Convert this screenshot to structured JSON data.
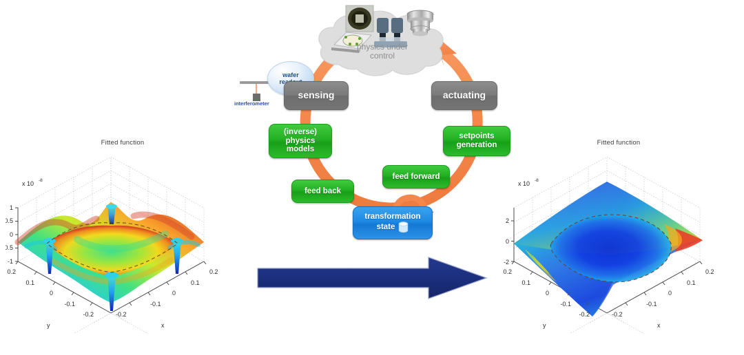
{
  "page": {
    "background": "#ffffff",
    "description": "Control loop diagram between two MATLAB fitted-function surface plots"
  },
  "colors": {
    "ring_orange": "#f4874b",
    "node_gray": "#7a7a7a",
    "node_green": "#23b023",
    "node_blue": "#1e8ae2",
    "bubble_blue": "#c3dcf4",
    "cloud_gray": "#dcdcdc",
    "cloud_text": "#8d8d8d",
    "arrow_navy": "#1b2f7e",
    "interferometer_text": "#2a4fb5"
  },
  "loop": {
    "cloud": {
      "label": "physics under control",
      "line1": "physics under",
      "line2": "control",
      "icons": [
        "wafer-image-icon",
        "wafer-stage-icon",
        "microscope-icon",
        "lens-barrel-icon"
      ]
    },
    "bubble": {
      "line1": "wafer",
      "line2": "readout",
      "label": "wafer readout"
    },
    "interferometer_label": "interferometer",
    "nodes": [
      {
        "id": "sensing",
        "label": "sensing",
        "style": "gray",
        "lines": [
          "sensing"
        ]
      },
      {
        "id": "actuating",
        "label": "actuating",
        "style": "gray",
        "lines": [
          "actuating"
        ]
      },
      {
        "id": "inverse-physics-models",
        "label": "(inverse) physics models",
        "style": "green",
        "lines": [
          "(inverse)",
          "physics",
          "models"
        ]
      },
      {
        "id": "setpoints-generation",
        "label": "setpoints generation",
        "style": "green",
        "lines": [
          "setpoints",
          "generation"
        ]
      },
      {
        "id": "feed-back",
        "label": "feed back",
        "style": "green",
        "lines": [
          "feed back"
        ]
      },
      {
        "id": "feed-forward",
        "label": "feed forward",
        "style": "green",
        "lines": [
          "feed forward"
        ]
      },
      {
        "id": "transformation-state",
        "label": "transformation state",
        "style": "blue",
        "lines": [
          "transformation",
          "state"
        ],
        "icon": "database-cylinder-icon"
      }
    ],
    "ring": {
      "direction": "counter-clockwise",
      "arrowhead": "top-right-pointing-into-cloud"
    },
    "inner_arrow": {
      "from": "feed-forward",
      "to": "transformation-state-right",
      "shape": "small-orange-curved-arrow"
    }
  },
  "transition_arrow": {
    "name": "big-right-arrow",
    "direction": "right",
    "color": "#1b2f7e"
  },
  "chart_data": [
    {
      "id": "left-plot",
      "type": "surface",
      "title": "Fitted function",
      "xlabel": "x",
      "ylabel": "y",
      "zlabel": "",
      "z_exponent_label": "x 10",
      "z_exponent_value": "-8",
      "xticks": [
        "0.2",
        "0.1",
        "0",
        "-0.1",
        "-0.2"
      ],
      "yticks": [
        "0.2",
        "0.1",
        "0",
        "-0.1",
        "-0.2"
      ],
      "zticks": [
        "1",
        "0.5",
        "0",
        "-0.5",
        "-1"
      ],
      "xlim": [
        -0.2,
        0.2
      ],
      "ylim": [
        -0.2,
        0.2
      ],
      "zlim": [
        -1,
        1
      ],
      "grid": true,
      "colormap": "jet",
      "annotation": "dashed contour ring on surface",
      "surface_character": "rough wavy surface with four deep blue spikes near the corners and red/orange ridges; residual before correction"
    },
    {
      "id": "right-plot",
      "type": "surface",
      "title": "Fitted function",
      "xlabel": "x",
      "ylabel": "y",
      "zlabel": "",
      "z_exponent_label": "x 10",
      "z_exponent_value": "-8",
      "xticks": [
        "0.2",
        "0.1",
        "0",
        "-0.1",
        "-0.2"
      ],
      "yticks": [
        "0.2",
        "0.1",
        "0",
        "-0.1",
        "-0.2"
      ],
      "zticks": [
        "2",
        "0",
        "-2"
      ],
      "xlim": [
        -0.2,
        0.2
      ],
      "ylim": [
        -0.2,
        0.2
      ],
      "zlim": [
        -2,
        2
      ],
      "grid": true,
      "colormap": "jet",
      "annotation": "dashed contour ring on surface",
      "surface_character": "smooth saddle surface, deep blue bowl in the centre rising to red at the right corner; residual after correction"
    }
  ]
}
